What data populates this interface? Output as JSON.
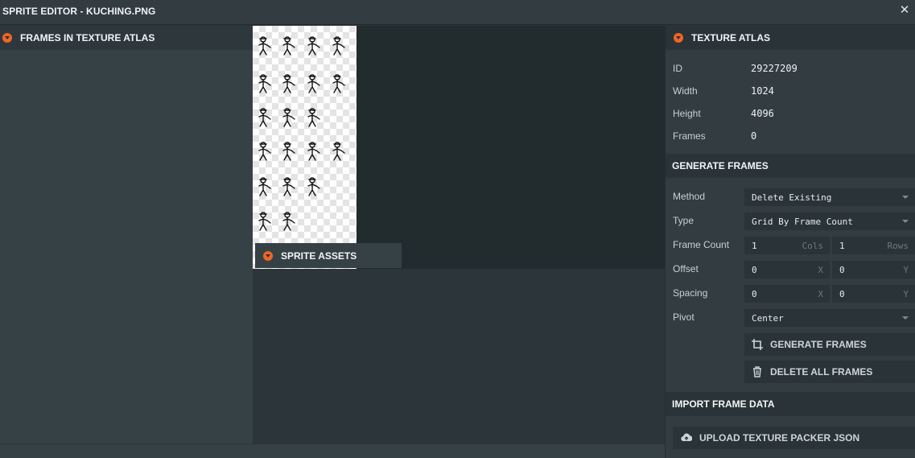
{
  "window": {
    "title": "SPRITE EDITOR - KUCHING.PNG",
    "close_symbol": "✕",
    "close_icon": "close-icon"
  },
  "accent_color": "#f26522",
  "frames_panel": {
    "title": "FRAMES IN TEXTURE ATLAS"
  },
  "assets_panel": {
    "title": "SPRITE ASSETS"
  },
  "texture_atlas": {
    "title": "TEXTURE ATLAS",
    "fields": [
      {
        "label": "ID",
        "value": "29227209"
      },
      {
        "label": "Width",
        "value": "1024"
      },
      {
        "label": "Height",
        "value": "4096"
      },
      {
        "label": "Frames",
        "value": "0"
      }
    ]
  },
  "generate_frames": {
    "title": "GENERATE FRAMES",
    "method": {
      "label": "Method",
      "value": "Delete Existing"
    },
    "type": {
      "label": "Type",
      "value": "Grid By Frame Count"
    },
    "frame_count": {
      "label": "Frame Count",
      "cols": "1",
      "cols_suffix": "Cols",
      "rows": "1",
      "rows_suffix": "Rows"
    },
    "offset": {
      "label": "Offset",
      "x": "0",
      "x_suffix": "X",
      "y": "0",
      "y_suffix": "Y"
    },
    "spacing": {
      "label": "Spacing",
      "x": "0",
      "x_suffix": "X",
      "y": "0",
      "y_suffix": "Y"
    },
    "pivot": {
      "label": "Pivot",
      "value": "Center"
    },
    "generate_button": "GENERATE FRAMES",
    "delete_button": "DELETE ALL FRAMES"
  },
  "import_frame_data": {
    "title": "IMPORT FRAME DATA",
    "upload_button": "UPLOAD TEXTURE PACKER JSON"
  }
}
